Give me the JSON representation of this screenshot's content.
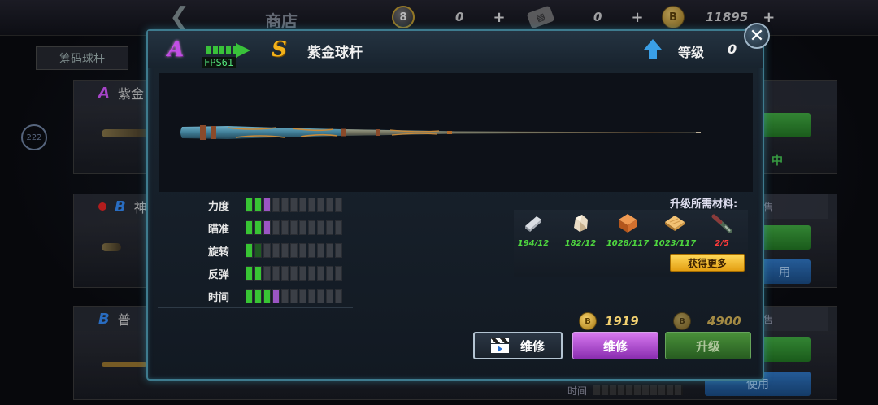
{
  "shop": {
    "title": "商店",
    "currency": [
      {
        "icon": "eight-ball-icon",
        "value": "0"
      },
      {
        "icon": "card-icon",
        "value": "0"
      },
      {
        "icon": "coin-icon",
        "value": "11895"
      }
    ],
    "tab_label": "筹码球杆",
    "side_badge": "222",
    "cards": [
      {
        "grade": "A",
        "name": "紫金"
      },
      {
        "grade": "B",
        "name": "神"
      },
      {
        "grade": "B",
        "name": "普"
      }
    ],
    "equipped_label": "中",
    "use_labels": [
      "用",
      "使用"
    ],
    "sell_label": "出售",
    "time_label": "时间"
  },
  "modal": {
    "grade_from": "A",
    "grade_to": "S",
    "fps_overlay": "FPS61",
    "cue_name": "紫金球杆",
    "level_label": "等级",
    "level_value": "0",
    "close_glyph": "✕",
    "stats": [
      {
        "label": "力度",
        "green": 2,
        "purple": 1,
        "darkgreen": 0,
        "total": 11
      },
      {
        "label": "瞄准",
        "green": 2,
        "purple": 1,
        "darkgreen": 0,
        "total": 11
      },
      {
        "label": "旋转",
        "green": 1,
        "purple": 0,
        "darkgreen": 1,
        "total": 11
      },
      {
        "label": "反弹",
        "green": 2,
        "purple": 0,
        "darkgreen": 0,
        "total": 11
      },
      {
        "label": "时间",
        "green": 3,
        "purple": 1,
        "darkgreen": 0,
        "total": 11
      }
    ],
    "materials_title": "升级所需材料:",
    "materials": [
      {
        "icon": "silver-bar-icon",
        "count": "194/12",
        "enough": true
      },
      {
        "icon": "ore-rock-icon",
        "count": "182/12",
        "enough": true
      },
      {
        "icon": "copper-block-icon",
        "count": "1028/117",
        "enough": true
      },
      {
        "icon": "wood-plank-icon",
        "count": "1023/117",
        "enough": true
      },
      {
        "icon": "cue-fragment-icon",
        "count": "2/5",
        "enough": false
      }
    ],
    "get_more_label": "获得更多",
    "repair_price": "1919",
    "upgrade_price": "4900",
    "video_repair_label": "维修",
    "repair_label": "维修",
    "upgrade_label": "升级"
  }
}
